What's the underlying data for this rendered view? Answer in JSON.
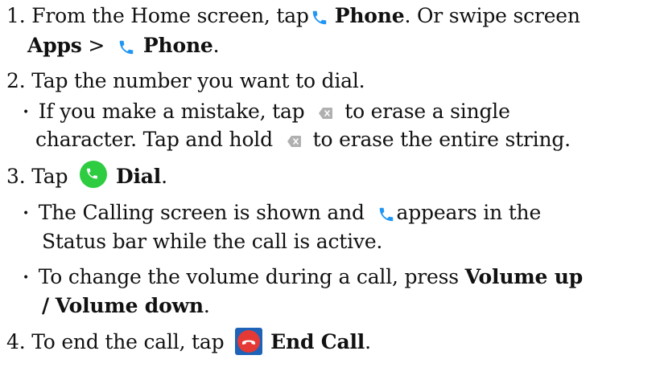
{
  "step1": {
    "num": "1.",
    "text_a": "From the Home screen, tap",
    "phone_label": "Phone",
    "text_b": ". Or swipe screen",
    "apps_label": "Apps",
    "separator": ">",
    "phone_label_2": "Phone",
    "end_period": "."
  },
  "step2": {
    "num": "2.",
    "text": "Tap the number you want to dial.",
    "bullet_a1": "If you make a mistake, tap",
    "bullet_a2": "to erase a single",
    "bullet_b1": "character. Tap and hold",
    "bullet_b2": "to erase the entire string."
  },
  "step3": {
    "num": "3.",
    "text_a": "Tap",
    "dial_label": "Dial",
    "end_period": ".",
    "bullet1_a": "The Calling screen is shown and",
    "bullet1_b": "appears in the",
    "bullet1_c": "Status bar while the call is active.",
    "bullet2_a": "To change the volume during a call, press",
    "bullet2_vol_up": "Volume up",
    "bullet2_slash": "/",
    "bullet2_vol_down": "Volume down",
    "bullet2_period": "."
  },
  "step4": {
    "num": "4.",
    "text_a": "To end the call, tap",
    "end_call_label": "End Call",
    "end_period": "."
  },
  "bullet_char": "•",
  "icons": {
    "phone": "phone-handset-icon",
    "backspace": "backspace-icon",
    "dial": "dial-button-icon",
    "end_call": "end-call-icon"
  },
  "colors": {
    "phone_blue": "#2196f3",
    "dial_green": "#2ecc40",
    "end_red": "#e53935",
    "backspace_gray": "#b0b0b0",
    "text": "#111111"
  }
}
